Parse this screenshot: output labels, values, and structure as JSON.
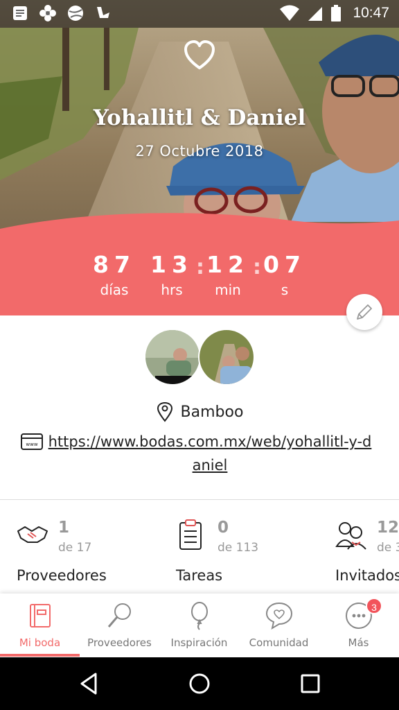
{
  "status_bar": {
    "time": "10:47",
    "icons": [
      "notes-icon",
      "flower-icon",
      "ball-icon",
      "cart-icon",
      "wifi-icon",
      "signal-icon",
      "battery-icon"
    ]
  },
  "hero": {
    "couple_names": "Yohallitl & Daniel",
    "date": "27 Octubre 2018"
  },
  "countdown": {
    "days": "87",
    "days_label": "días",
    "hours": "13",
    "hours_label": "hrs",
    "minutes": "12",
    "minutes_label": "min",
    "seconds": "07",
    "seconds_label": "s",
    "separator": ":"
  },
  "info": {
    "venue": "Bamboo",
    "website": "https://www.bodas.com.mx/web/yohallitl-y-daniel"
  },
  "stats": [
    {
      "icon": "handshake-icon",
      "count": "1",
      "total": "de 17",
      "label": "Proveedores"
    },
    {
      "icon": "clipboard-icon",
      "count": "0",
      "total": "de 113",
      "label": "Tareas"
    },
    {
      "icon": "guests-icon",
      "count": "12",
      "total": "de 3",
      "label": "Invitados"
    }
  ],
  "bottom_nav": {
    "items": [
      {
        "label": "Mi boda",
        "icon": "notebook-icon"
      },
      {
        "label": "Proveedores",
        "icon": "search-icon"
      },
      {
        "label": "Inspiración",
        "icon": "balloon-icon"
      },
      {
        "label": "Comunidad",
        "icon": "chat-heart-icon"
      },
      {
        "label": "Más",
        "icon": "more-icon"
      }
    ],
    "more_badge": "3"
  },
  "colors": {
    "accent": "#f26a6a",
    "badge": "#f2545b"
  }
}
